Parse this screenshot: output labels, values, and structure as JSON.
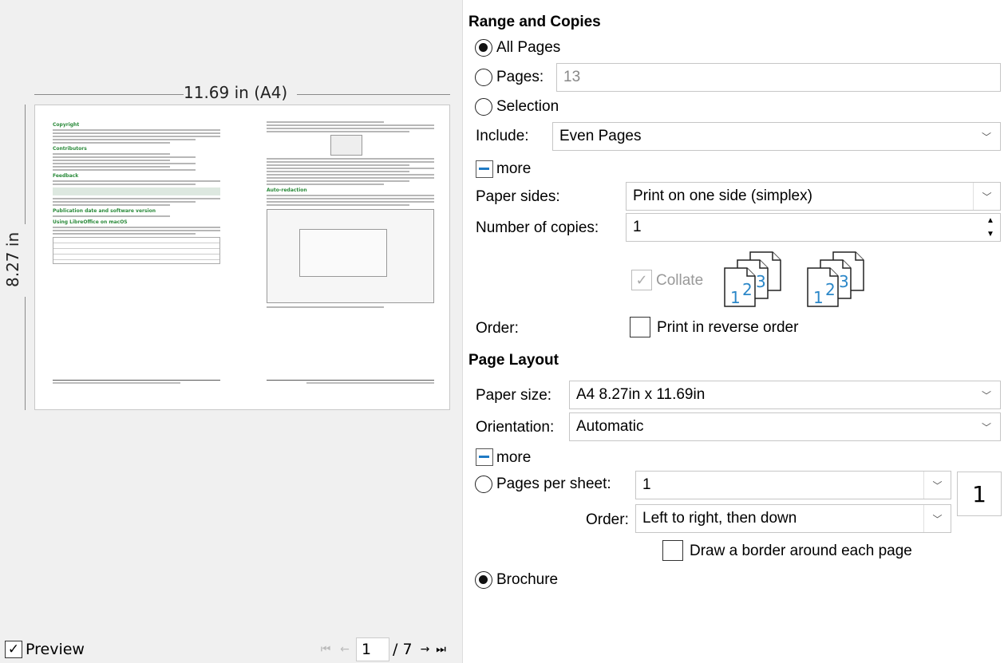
{
  "preview": {
    "width_label": "11.69 in (A4)",
    "height_label": "8.27 in",
    "left_page": {
      "h_copyright": "Copyright",
      "h_contributors": "Contributors",
      "h_feedback": "Feedback",
      "h_pubdate": "Publication date and software version",
      "h_macos": "Using LibreOffice on macOS"
    },
    "right_page": {
      "h_autoredaction": "Auto-redaction"
    },
    "checkbox_label": "Preview",
    "page_current": "1",
    "page_total": "/ 7"
  },
  "range": {
    "title": "Range and Copies",
    "all_pages": "All Pages",
    "pages_label": "Pages:",
    "pages_value": "13",
    "selection": "Selection",
    "include_label": "Include:",
    "include_value": "Even Pages",
    "more": "more",
    "paper_sides_label": "Paper sides:",
    "paper_sides_value": "Print on one side (simplex)",
    "copies_label": "Number of copies:",
    "copies_value": "1",
    "collate": "Collate",
    "order_label": "Order:",
    "reverse": "Print in reverse order"
  },
  "layout": {
    "title": "Page Layout",
    "paper_size_label": "Paper size:",
    "paper_size_value": "A4 8.27in x 11.69in",
    "orientation_label": "Orientation:",
    "orientation_value": "Automatic",
    "more": "more",
    "pps_label": "Pages per sheet:",
    "pps_value": "1",
    "pps_box": "1",
    "order_label": "Order:",
    "order_value": "Left to right, then down",
    "border": "Draw a border around each page",
    "brochure": "Brochure"
  },
  "collate_icons": {
    "digit1": "1",
    "digit2": "2",
    "digit3": "3"
  }
}
